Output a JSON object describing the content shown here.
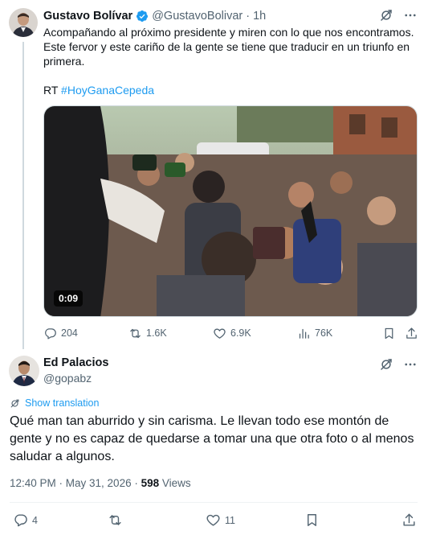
{
  "tweet1": {
    "name": "Gustavo Bolívar",
    "handle": "@GustavoBolivar",
    "separator": "·",
    "time": "1h",
    "text_lines": [
      "Acompañando al próximo presidente y miren con lo que nos encontramos.",
      "Este fervor y este cariño de la gente se tiene que traducir en un triunfo en",
      "primera."
    ],
    "rt_prefix": "RT",
    "hashtag": "#HoyGanaCepeda",
    "video_duration": "0:09",
    "metrics": {
      "replies": "204",
      "retweets": "1.6K",
      "likes": "6.9K",
      "views": "76K"
    }
  },
  "tweet2": {
    "name": "Ed Palacios",
    "handle": "@gopabz",
    "show_translation": "Show translation",
    "text": "Qué man tan aburrido y sin carisma. Le llevan todo ese montón de gente y no es capaz de quedarse a tomar una que otra foto o al menos saludar a algunos.",
    "time": "12:40 PM · May 31, 2026 · ",
    "views_count": "598",
    "views_label": " Views",
    "metrics": {
      "replies": "4",
      "likes": "11"
    }
  },
  "icons": {
    "verified": "verified-badge-icon",
    "grok": "grok-icon",
    "more": "more-icon",
    "reply": "reply-icon",
    "retweet": "retweet-icon",
    "like": "heart-icon",
    "views": "views-chart-icon",
    "bookmark": "bookmark-icon",
    "share": "share-icon",
    "translate": "translate-icon"
  },
  "colors": {
    "accent": "#1d9bf0",
    "muted": "#536471",
    "text": "#0f1419",
    "border": "#cfd9de"
  }
}
